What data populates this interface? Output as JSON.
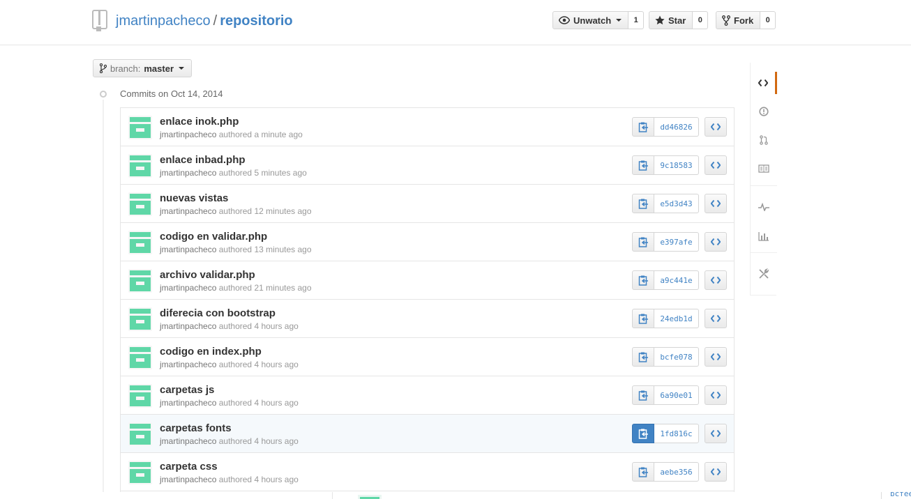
{
  "repo": {
    "owner": "jmartinpacheco",
    "separator": "/",
    "name": "repositorio"
  },
  "actions": {
    "unwatch_label": "Unwatch",
    "unwatch_count": "1",
    "star_label": "Star",
    "star_count": "0",
    "fork_label": "Fork",
    "fork_count": "0"
  },
  "branch": {
    "label": "branch:",
    "value": "master"
  },
  "commits_heading": {
    "prefix": "Commits on",
    "date": "Oct 14, 2014"
  },
  "commits": [
    {
      "message": "enlace inok.php",
      "author": "jmartinpacheco",
      "authored": "authored",
      "time": "a minute ago",
      "sha": "dd46826"
    },
    {
      "message": "enlace inbad.php",
      "author": "jmartinpacheco",
      "authored": "authored",
      "time": "5 minutes ago",
      "sha": "9c18583"
    },
    {
      "message": "nuevas vistas",
      "author": "jmartinpacheco",
      "authored": "authored",
      "time": "12 minutes ago",
      "sha": "e5d3d43"
    },
    {
      "message": "codigo en validar.php",
      "author": "jmartinpacheco",
      "authored": "authored",
      "time": "13 minutes ago",
      "sha": "e397afe"
    },
    {
      "message": "archivo validar.php",
      "author": "jmartinpacheco",
      "authored": "authored",
      "time": "21 minutes ago",
      "sha": "a9c441e"
    },
    {
      "message": "diferecia con bootstrap",
      "author": "jmartinpacheco",
      "authored": "authored",
      "time": "4 hours ago",
      "sha": "24edb1d"
    },
    {
      "message": "codigo en index.php",
      "author": "jmartinpacheco",
      "authored": "authored",
      "time": "4 hours ago",
      "sha": "bcfe078"
    },
    {
      "message": "carpetas js",
      "author": "jmartinpacheco",
      "authored": "authored",
      "time": "4 hours ago",
      "sha": "6a90e01"
    },
    {
      "message": "carpetas fonts",
      "author": "jmartinpacheco",
      "authored": "authored",
      "time": "4 hours ago",
      "sha": "1fd816c"
    },
    {
      "message": "carpeta css",
      "author": "jmartinpacheco",
      "authored": "authored",
      "time": "4 hours ago",
      "sha": "aebe356"
    }
  ],
  "partial_row": {
    "sha": "bcfee"
  },
  "sidenav": {
    "items": [
      "code-icon",
      "issue-icon",
      "pull-request-icon",
      "wiki-icon",
      "pulse-icon",
      "graph-icon",
      "settings-icon"
    ],
    "selected": "code-icon"
  },
  "colors": {
    "link": "#4183c4",
    "avatar": "#5fd7a7",
    "selected_nav": "#d26911",
    "active_button": "#4183c4"
  }
}
